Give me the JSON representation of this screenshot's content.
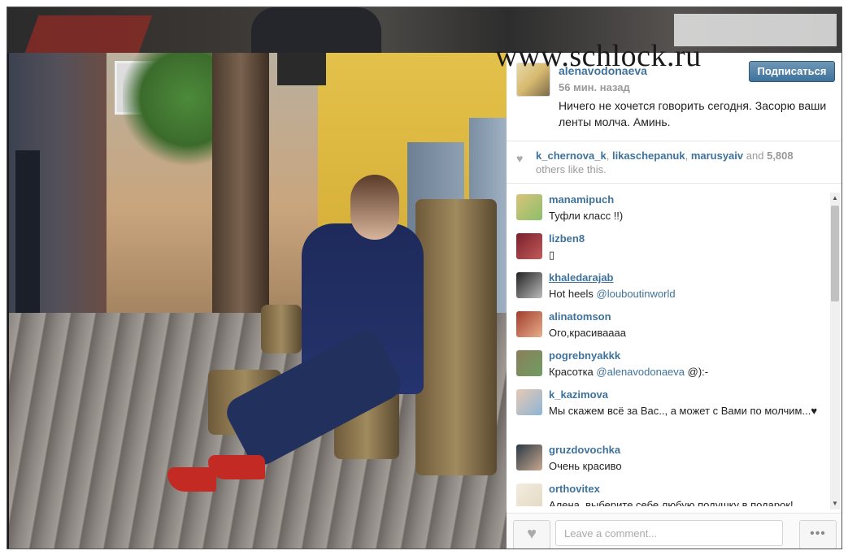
{
  "watermark": "www.schlock.ru",
  "post": {
    "username": "alenavodonaeva",
    "time": "56 мин. назад",
    "caption": "Ничего не хочется говорить сегодня. Засорю ваши ленты молча. Аминь.",
    "follow_label": "Подписаться",
    "follow_color": "#3f729b"
  },
  "likes": {
    "user1": "k_chernova_k",
    "user2": "likaschepanuk",
    "user3": "marusyaiv",
    "and": "and",
    "count": "5,808",
    "tail": "others like this."
  },
  "comments": [
    {
      "user": "manamipuch",
      "text": "Туфли класс !!)"
    },
    {
      "user": "lizben8",
      "text": ""
    },
    {
      "user": "khaledarajab",
      "text_pre": "Hot heels ",
      "mention": "@louboutinworld"
    },
    {
      "user": "alinatomson",
      "text": "Ого,красиваааа"
    },
    {
      "user": "pogrebnyakkk",
      "text_pre": "Красотка ",
      "mention": "@alenavodonaeva",
      "text_post": " @):-"
    },
    {
      "user": "k_kazimova",
      "text": "Мы скажем всё за Вас.., а может с Вами по молчим...♥"
    },
    {
      "user": "gruzdovochka",
      "text": "Очень красиво"
    },
    {
      "user": "orthovitex",
      "text": "Алена, выберите себе любую подушку в подарок!"
    }
  ],
  "footer": {
    "comment_placeholder": "Leave a comment...",
    "like_icon": "heart-icon",
    "more_icon": "ellipsis-icon",
    "more_label": "•••"
  }
}
